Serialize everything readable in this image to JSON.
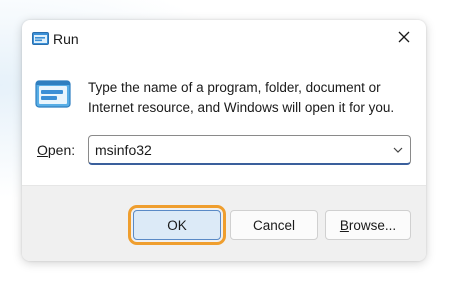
{
  "window": {
    "title": "Run",
    "icon": "run-icon",
    "close_icon": "close-icon"
  },
  "content": {
    "description": "Type the name of a program, folder, document or Internet resource, and Windows will open it for you.",
    "description_line1": "Type the name of a program, folder, document or",
    "description_line2": "Internet resource, and Windows will open it for you."
  },
  "open_field": {
    "label_access_key": "O",
    "label_rest": "pen:",
    "value": "msinfo32",
    "dropdown_icon": "chevron-down-icon"
  },
  "buttons": {
    "ok": "OK",
    "cancel": "Cancel",
    "browse_access_key": "B",
    "browse_rest": "rowse..."
  },
  "colors": {
    "focus_highlight": "#ef9e2e",
    "ok_fill": "#dceaf7",
    "input_underline": "#3a5f9c"
  }
}
